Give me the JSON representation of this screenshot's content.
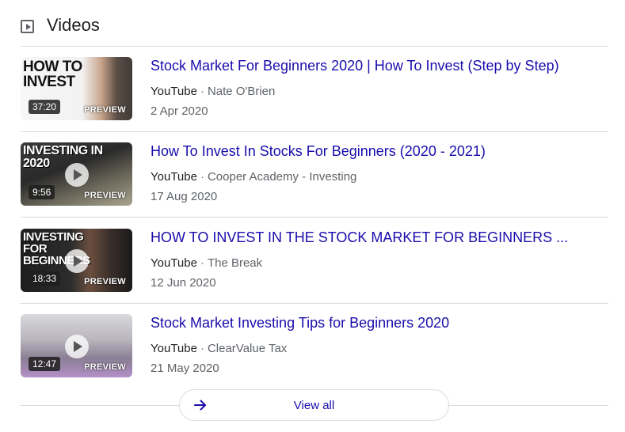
{
  "header": {
    "title": "Videos"
  },
  "videos": [
    {
      "title": "Stock Market For Beginners 2020 | How To Invest (Step by Step)",
      "source": "YouTube",
      "channel": "Nate O'Brien",
      "date": "2 Apr 2020",
      "duration": "37:20",
      "preview_label": "PREVIEW",
      "thumb_text": "HOW TO INVEST"
    },
    {
      "title": "How To Invest In Stocks For Beginners (2020 - 2021)",
      "source": "YouTube",
      "channel": "Cooper Academy - Investing",
      "date": "17 Aug 2020",
      "duration": "9:56",
      "preview_label": "PREVIEW",
      "thumb_text": "INVESTING IN 2020"
    },
    {
      "title": "HOW TO INVEST IN THE STOCK MARKET FOR BEGINNERS ...",
      "source": "YouTube",
      "channel": "The Break",
      "date": "12 Jun 2020",
      "duration": "18:33",
      "preview_label": "PREVIEW",
      "thumb_text": "INVESTING FOR BEGINNERS"
    },
    {
      "title": "Stock Market Investing Tips for Beginners 2020",
      "source": "YouTube",
      "channel": "ClearValue Tax",
      "date": "21 May 2020",
      "duration": "12:47",
      "preview_label": "PREVIEW",
      "thumb_text": ""
    }
  ],
  "footer": {
    "view_all_label": "View all"
  },
  "colors": {
    "link": "#1a0dab",
    "meta": "#5f6368",
    "divider": "#dadce0"
  }
}
